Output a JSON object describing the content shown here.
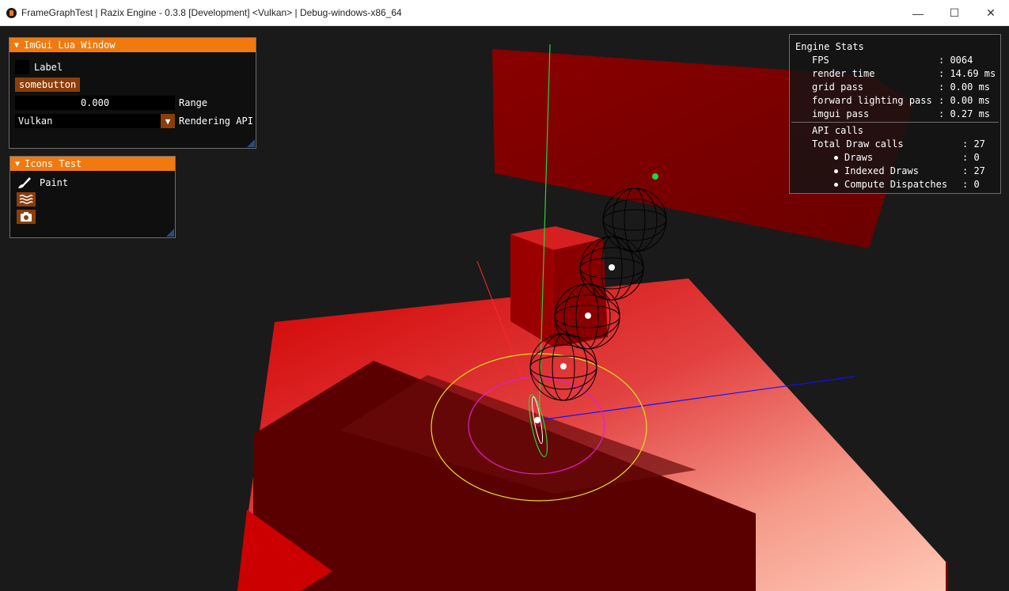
{
  "window": {
    "title": "FrameGraphTest | Razix Engine - 0.3.8 [Development] <Vulkan> |  Debug-windows-x86_64",
    "controls": {
      "minimize": "—",
      "maximize": "☐",
      "close": "✕"
    }
  },
  "imgui_lua_window": {
    "title": "ImGui Lua Window",
    "checkbox_label": "Label",
    "button_label": "somebutton",
    "range_value": "0.000",
    "range_label": "Range",
    "combo_value": "Vulkan",
    "combo_label": "Rendering API"
  },
  "icons_test_window": {
    "title": "Icons Test",
    "paint_label": "Paint"
  },
  "engine_stats": {
    "title": "Engine Stats",
    "rows": [
      {
        "key": "FPS",
        "value": ": 0064"
      },
      {
        "key": "render time",
        "value": ": 14.69 ms"
      },
      {
        "key": "grid pass",
        "value": ": 0.00 ms"
      },
      {
        "key": "forward lighting pass",
        "value": ": 0.00 ms"
      },
      {
        "key": "imgui pass",
        "value": ": 0.27 ms"
      }
    ],
    "api_calls_label": "API calls",
    "total_draw_calls": {
      "key": "Total Draw calls",
      "value": ": 27"
    },
    "calls": [
      {
        "key": "Draws",
        "value": ": 0"
      },
      {
        "key": "Indexed Draws",
        "value": ": 27"
      },
      {
        "key": "Compute Dispatches",
        "value": ": 0"
      }
    ]
  },
  "colors": {
    "imgui_title": "#f07a10",
    "imgui_button": "#8b3e0a",
    "viewport_bg": "#1a1a1a"
  }
}
